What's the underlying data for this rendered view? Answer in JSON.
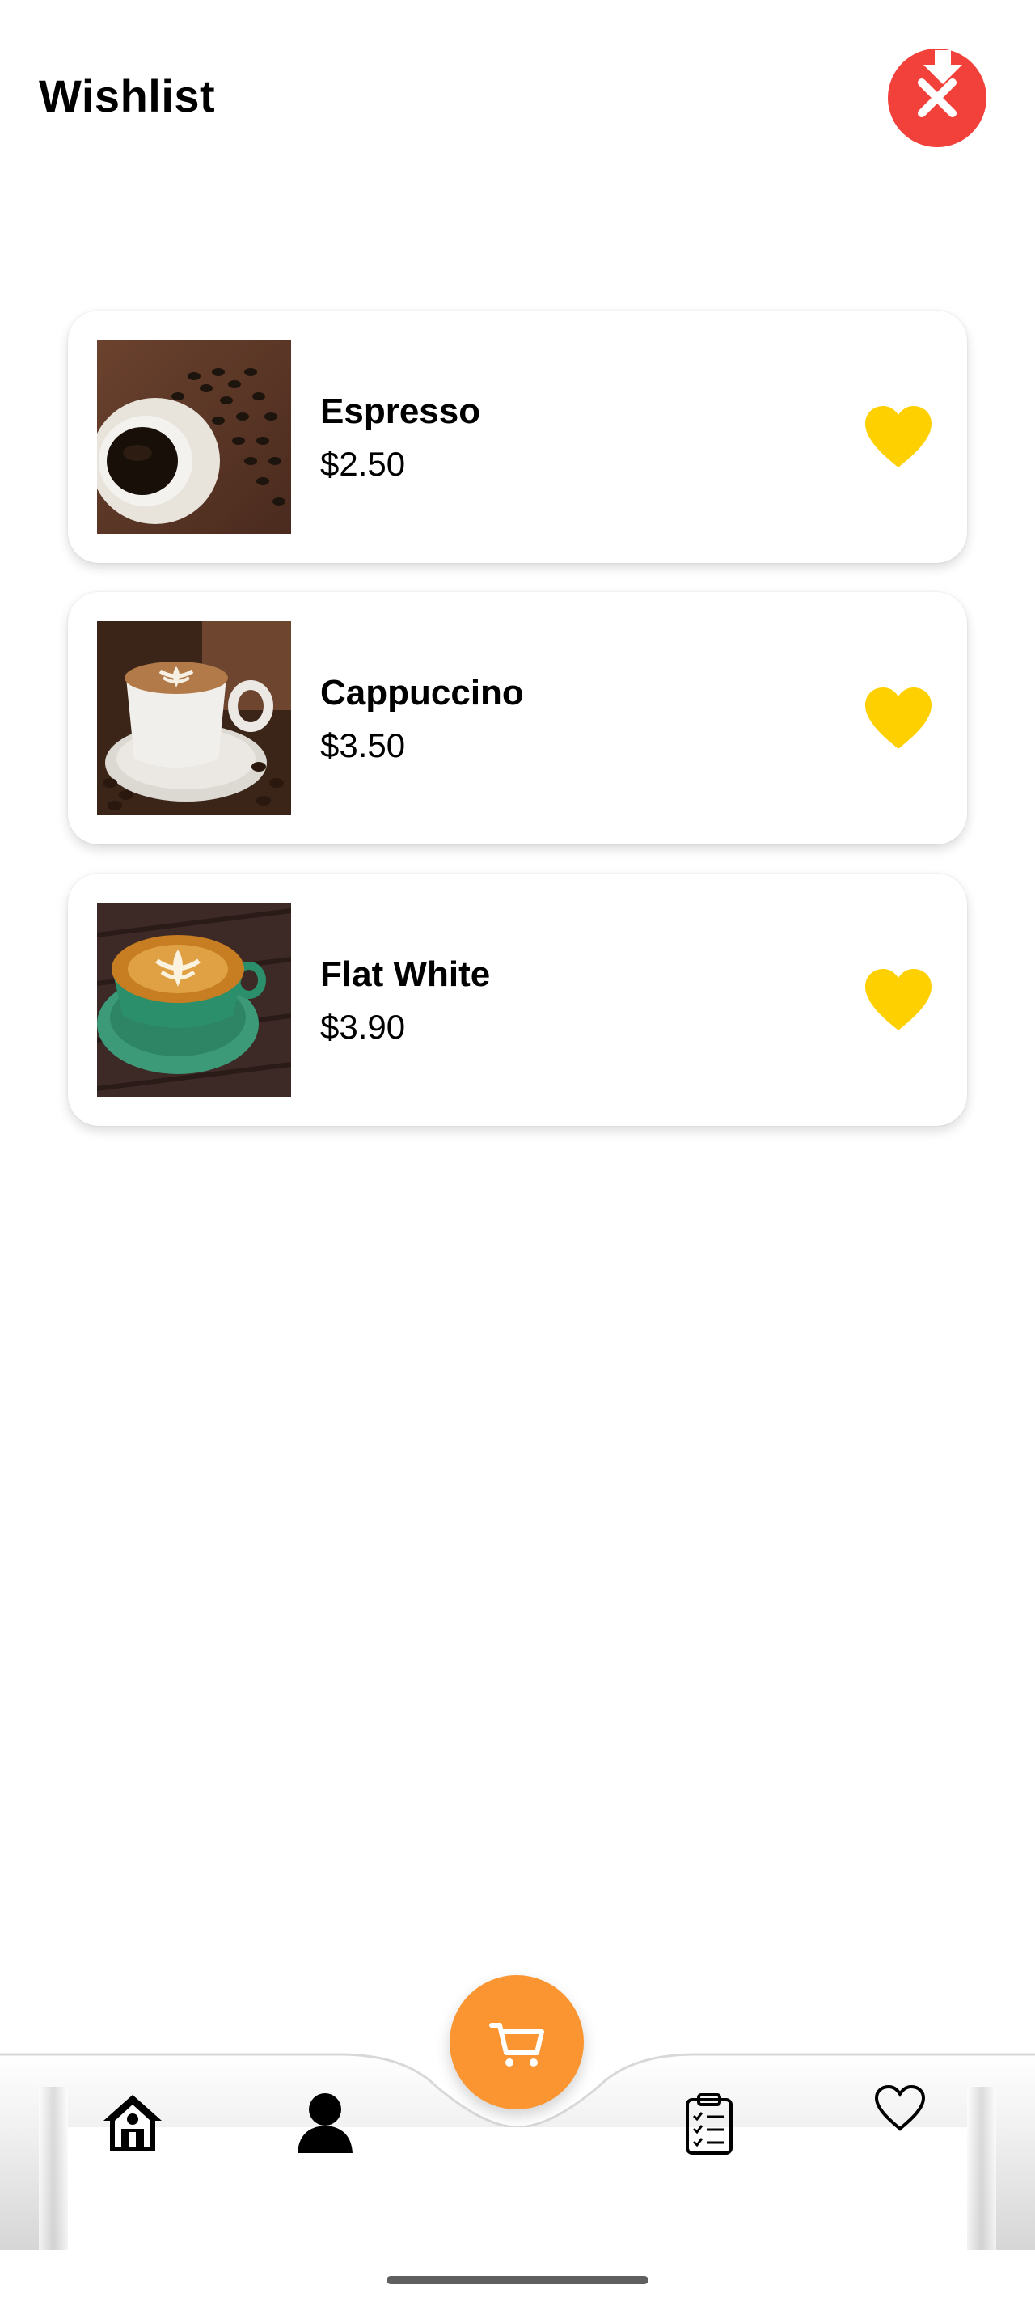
{
  "header": {
    "title": "Wishlist",
    "clear_icon": "close-icon",
    "clear_color": "#f2413a"
  },
  "wishlist": {
    "items": [
      {
        "name": "Espresso",
        "price": "$2.50",
        "image": "espresso-photo",
        "favorite": true
      },
      {
        "name": "Cappuccino",
        "price": "$3.50",
        "image": "cappuccino-photo",
        "favorite": true
      },
      {
        "name": "Flat White",
        "price": "$3.90",
        "image": "flat-white-photo",
        "favorite": true
      }
    ],
    "heart_color": "#ffd000"
  },
  "bottom_nav": {
    "items": [
      {
        "icon": "home-icon"
      },
      {
        "icon": "profile-icon"
      },
      {
        "icon": "cart-icon"
      },
      {
        "icon": "orders-clipboard-icon"
      },
      {
        "icon": "heart-outline-icon"
      }
    ],
    "fab_color": "#fa9531"
  }
}
